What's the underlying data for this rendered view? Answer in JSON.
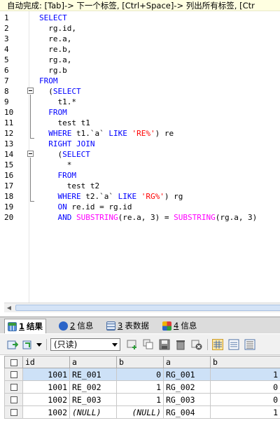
{
  "autocomplete_hint": "自动完成: [Tab]-> 下一个标签, [Ctrl+Space]-> 列出所有标签, [Ctr",
  "editor": {
    "line_numbers": [
      "1",
      "2",
      "3",
      "4",
      "5",
      "6",
      "7",
      "8",
      "9",
      "10",
      "11",
      "12",
      "13",
      "14",
      "15",
      "16",
      "17",
      "18",
      "19",
      "20"
    ],
    "lines": [
      [
        {
          "t": "SELECT",
          "c": "kw"
        }
      ],
      [
        {
          "t": "  rg.id,",
          "c": ""
        }
      ],
      [
        {
          "t": "  re.a,",
          "c": ""
        }
      ],
      [
        {
          "t": "  re.b,",
          "c": ""
        }
      ],
      [
        {
          "t": "  rg.a,",
          "c": ""
        }
      ],
      [
        {
          "t": "  rg.b",
          "c": ""
        }
      ],
      [
        {
          "t": "FROM",
          "c": "kw"
        }
      ],
      [
        {
          "t": "  (",
          "c": ""
        },
        {
          "t": "SELECT",
          "c": "kw"
        }
      ],
      [
        {
          "t": "    t1.*",
          "c": ""
        }
      ],
      [
        {
          "t": "  ",
          "c": ""
        },
        {
          "t": "FROM",
          "c": "kw"
        }
      ],
      [
        {
          "t": "    test t1",
          "c": ""
        }
      ],
      [
        {
          "t": "  ",
          "c": ""
        },
        {
          "t": "WHERE",
          "c": "kw"
        },
        {
          "t": " t1.`a` ",
          "c": ""
        },
        {
          "t": "LIKE",
          "c": "kw"
        },
        {
          "t": " ",
          "c": ""
        },
        {
          "t": "'RE%'",
          "c": "str"
        },
        {
          "t": ") re",
          "c": ""
        }
      ],
      [
        {
          "t": "  ",
          "c": ""
        },
        {
          "t": "RIGHT JOIN",
          "c": "kw"
        }
      ],
      [
        {
          "t": "    (",
          "c": ""
        },
        {
          "t": "SELECT",
          "c": "kw"
        }
      ],
      [
        {
          "t": "      *",
          "c": ""
        }
      ],
      [
        {
          "t": "    ",
          "c": ""
        },
        {
          "t": "FROM",
          "c": "kw"
        }
      ],
      [
        {
          "t": "      test t2",
          "c": ""
        }
      ],
      [
        {
          "t": "    ",
          "c": ""
        },
        {
          "t": "WHERE",
          "c": "kw"
        },
        {
          "t": " t2.`a` ",
          "c": ""
        },
        {
          "t": "LIKE",
          "c": "kw"
        },
        {
          "t": " ",
          "c": ""
        },
        {
          "t": "'RG%'",
          "c": "str"
        },
        {
          "t": ") rg",
          "c": ""
        }
      ],
      [
        {
          "t": "    ",
          "c": ""
        },
        {
          "t": "ON",
          "c": "kw"
        },
        {
          "t": " re.id = rg.id",
          "c": ""
        }
      ],
      [
        {
          "t": "    ",
          "c": ""
        },
        {
          "t": "AND",
          "c": "kw"
        },
        {
          "t": " ",
          "c": ""
        },
        {
          "t": "SUBSTRING",
          "c": "fn"
        },
        {
          "t": "(re.a, 3) = ",
          "c": ""
        },
        {
          "t": "SUBSTRING",
          "c": "fn"
        },
        {
          "t": "(rg.a, 3)",
          "c": ""
        }
      ]
    ]
  },
  "tabs": [
    {
      "num": "1",
      "label": "结果",
      "icon": "result-grid-icon",
      "active": true
    },
    {
      "num": "2",
      "label": "信息",
      "icon": "info-icon",
      "active": false
    },
    {
      "num": "3",
      "label": "表数据",
      "icon": "table-data-icon",
      "active": false
    },
    {
      "num": "4",
      "label": "信息",
      "icon": "info-colored-icon",
      "active": false
    }
  ],
  "toolbar": {
    "mode_select_value": "(只读)",
    "icons": [
      "export-icon",
      "import-icon",
      "add-row-icon",
      "duplicate-row-icon",
      "save-icon",
      "delete-icon",
      "cancel-icon",
      "grid-view-icon",
      "form-view-icon",
      "text-view-icon"
    ]
  },
  "grid": {
    "columns": [
      "id",
      "a",
      "b",
      "a",
      "b"
    ],
    "rows": [
      [
        "1001",
        "RE_001",
        "0",
        "RG_001",
        "1"
      ],
      [
        "1001",
        "RE_002",
        "1",
        "RG_002",
        "0"
      ],
      [
        "1002",
        "RE_003",
        "1",
        "RG_003",
        "0"
      ],
      [
        "1002",
        "(NULL)",
        "(NULL)",
        "RG_004",
        "1"
      ]
    ]
  },
  "colors": {
    "keyword": "#0000ff",
    "string": "#ff0000",
    "function": "#ff00ff",
    "selection": "#cde1f7",
    "hint_background": "#ffffe1"
  }
}
